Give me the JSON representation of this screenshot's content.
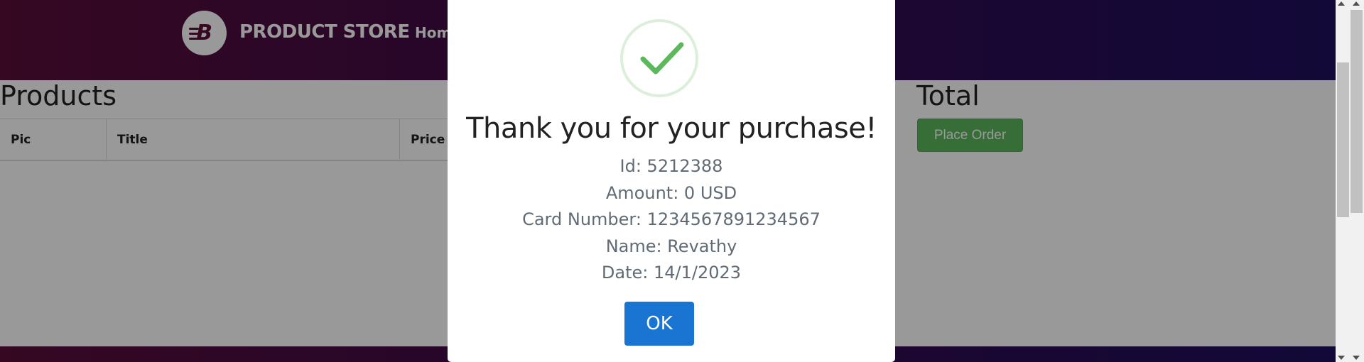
{
  "navbar": {
    "brand_name": "PRODUCT STORE",
    "brand_logo_letter": "B",
    "home_label": "Home"
  },
  "cart": {
    "products_heading": "Products",
    "table_headers": [
      "Pic",
      "Title",
      "Price"
    ],
    "total_heading": "Total",
    "place_order_label": "Place Order"
  },
  "modal": {
    "title": "Thank you for your purchase!",
    "lines": [
      "Id: 5212388",
      "Amount: 0 USD",
      "Card Number: 1234567891234567",
      "Name: Revathy",
      "Date: 14/1/2023"
    ],
    "ok_label": "OK",
    "success_icon": "checkmark-icon"
  },
  "colors": {
    "success_green": "#5cb85c",
    "ok_blue": "#1a74d2",
    "navbar_start": "#5a0e3a",
    "navbar_end": "#1e0f5e"
  }
}
